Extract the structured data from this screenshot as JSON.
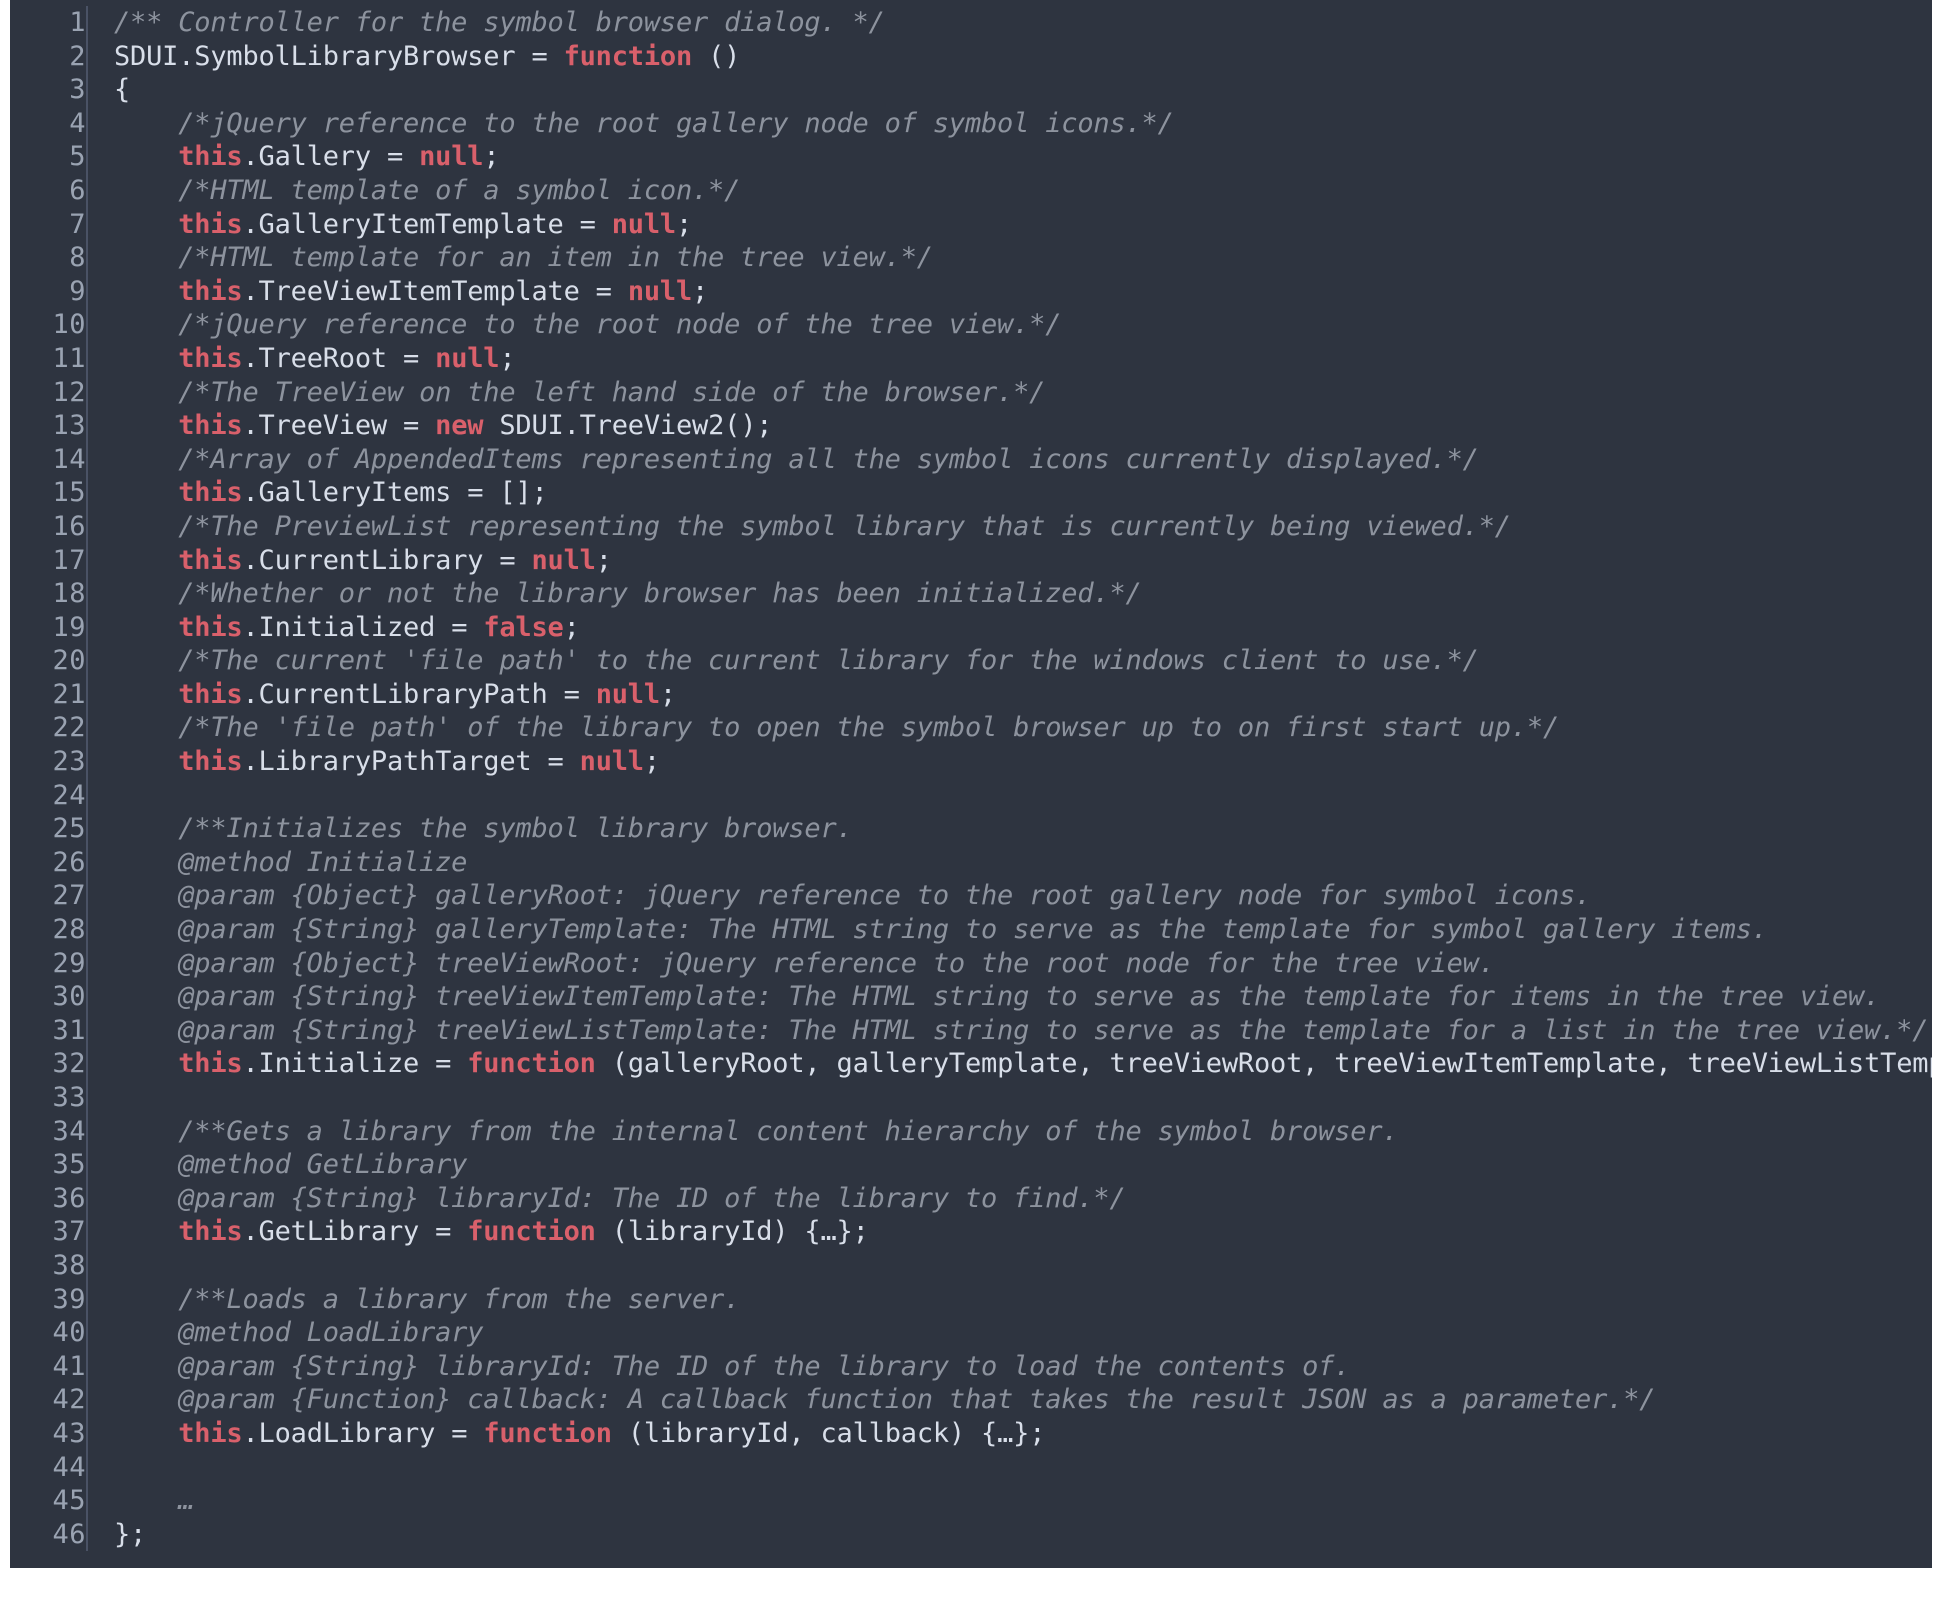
{
  "editor": {
    "background_color": "#2e3440",
    "gutter_color": "#9aa3b2",
    "gutter_divider_color": "#4a5265",
    "text_color": "#d8dee9",
    "comment_color": "#8d939e",
    "keyword_color": "#d9606b",
    "first_line_number": 1,
    "last_line_number": 46,
    "total_lines": 46,
    "language": "JavaScript"
  },
  "line_numbers": [
    "1",
    "2",
    "3",
    "4",
    "5",
    "6",
    "7",
    "8",
    "9",
    "10",
    "11",
    "12",
    "13",
    "14",
    "15",
    "16",
    "17",
    "18",
    "19",
    "20",
    "21",
    "22",
    "23",
    "24",
    "25",
    "26",
    "27",
    "28",
    "29",
    "30",
    "31",
    "32",
    "33",
    "34",
    "35",
    "36",
    "37",
    "38",
    "39",
    "40",
    "41",
    "42",
    "43",
    "44",
    "45",
    "46"
  ],
  "code_lines": [
    {
      "n": 1,
      "tokens": [
        {
          "t": "comment",
          "v": "/** Controller for the symbol browser dialog. */"
        }
      ]
    },
    {
      "n": 2,
      "tokens": [
        {
          "t": "plain",
          "v": "SDUI.SymbolLibraryBrowser = "
        },
        {
          "t": "keyword",
          "v": "function"
        },
        {
          "t": "plain",
          "v": " ()"
        }
      ]
    },
    {
      "n": 3,
      "tokens": [
        {
          "t": "plain",
          "v": "{"
        }
      ]
    },
    {
      "n": 4,
      "tokens": [
        {
          "t": "plain",
          "v": "    "
        },
        {
          "t": "comment",
          "v": "/*jQuery reference to the root gallery node of symbol icons.*/"
        }
      ]
    },
    {
      "n": 5,
      "tokens": [
        {
          "t": "plain",
          "v": "    "
        },
        {
          "t": "keyword",
          "v": "this"
        },
        {
          "t": "plain",
          "v": ".Gallery = "
        },
        {
          "t": "keyword",
          "v": "null"
        },
        {
          "t": "plain",
          "v": ";"
        }
      ]
    },
    {
      "n": 6,
      "tokens": [
        {
          "t": "plain",
          "v": "    "
        },
        {
          "t": "comment",
          "v": "/*HTML template of a symbol icon.*/"
        }
      ]
    },
    {
      "n": 7,
      "tokens": [
        {
          "t": "plain",
          "v": "    "
        },
        {
          "t": "keyword",
          "v": "this"
        },
        {
          "t": "plain",
          "v": ".GalleryItemTemplate = "
        },
        {
          "t": "keyword",
          "v": "null"
        },
        {
          "t": "plain",
          "v": ";"
        }
      ]
    },
    {
      "n": 8,
      "tokens": [
        {
          "t": "plain",
          "v": "    "
        },
        {
          "t": "comment",
          "v": "/*HTML template for an item in the tree view.*/"
        }
      ]
    },
    {
      "n": 9,
      "tokens": [
        {
          "t": "plain",
          "v": "    "
        },
        {
          "t": "keyword",
          "v": "this"
        },
        {
          "t": "plain",
          "v": ".TreeViewItemTemplate = "
        },
        {
          "t": "keyword",
          "v": "null"
        },
        {
          "t": "plain",
          "v": ";"
        }
      ]
    },
    {
      "n": 10,
      "tokens": [
        {
          "t": "plain",
          "v": "    "
        },
        {
          "t": "comment",
          "v": "/*jQuery reference to the root node of the tree view.*/"
        }
      ]
    },
    {
      "n": 11,
      "tokens": [
        {
          "t": "plain",
          "v": "    "
        },
        {
          "t": "keyword",
          "v": "this"
        },
        {
          "t": "plain",
          "v": ".TreeRoot = "
        },
        {
          "t": "keyword",
          "v": "null"
        },
        {
          "t": "plain",
          "v": ";"
        }
      ]
    },
    {
      "n": 12,
      "tokens": [
        {
          "t": "plain",
          "v": "    "
        },
        {
          "t": "comment",
          "v": "/*The TreeView on the left hand side of the browser.*/"
        }
      ]
    },
    {
      "n": 13,
      "tokens": [
        {
          "t": "plain",
          "v": "    "
        },
        {
          "t": "keyword",
          "v": "this"
        },
        {
          "t": "plain",
          "v": ".TreeView = "
        },
        {
          "t": "keyword",
          "v": "new"
        },
        {
          "t": "plain",
          "v": " SDUI.TreeView2();"
        }
      ]
    },
    {
      "n": 14,
      "tokens": [
        {
          "t": "plain",
          "v": "    "
        },
        {
          "t": "comment",
          "v": "/*Array of AppendedItems representing all the symbol icons currently displayed.*/"
        }
      ]
    },
    {
      "n": 15,
      "tokens": [
        {
          "t": "plain",
          "v": "    "
        },
        {
          "t": "keyword",
          "v": "this"
        },
        {
          "t": "plain",
          "v": ".GalleryItems = [];"
        }
      ]
    },
    {
      "n": 16,
      "tokens": [
        {
          "t": "plain",
          "v": "    "
        },
        {
          "t": "comment",
          "v": "/*The PreviewList representing the symbol library that is currently being viewed.*/"
        }
      ]
    },
    {
      "n": 17,
      "tokens": [
        {
          "t": "plain",
          "v": "    "
        },
        {
          "t": "keyword",
          "v": "this"
        },
        {
          "t": "plain",
          "v": ".CurrentLibrary = "
        },
        {
          "t": "keyword",
          "v": "null"
        },
        {
          "t": "plain",
          "v": ";"
        }
      ]
    },
    {
      "n": 18,
      "tokens": [
        {
          "t": "plain",
          "v": "    "
        },
        {
          "t": "comment",
          "v": "/*Whether or not the library browser has been initialized.*/"
        }
      ]
    },
    {
      "n": 19,
      "tokens": [
        {
          "t": "plain",
          "v": "    "
        },
        {
          "t": "keyword",
          "v": "this"
        },
        {
          "t": "plain",
          "v": ".Initialized = "
        },
        {
          "t": "keyword",
          "v": "false"
        },
        {
          "t": "plain",
          "v": ";"
        }
      ]
    },
    {
      "n": 20,
      "tokens": [
        {
          "t": "plain",
          "v": "    "
        },
        {
          "t": "comment",
          "v": "/*The current 'file path' to the current library for the windows client to use.*/"
        }
      ]
    },
    {
      "n": 21,
      "tokens": [
        {
          "t": "plain",
          "v": "    "
        },
        {
          "t": "keyword",
          "v": "this"
        },
        {
          "t": "plain",
          "v": ".CurrentLibraryPath = "
        },
        {
          "t": "keyword",
          "v": "null"
        },
        {
          "t": "plain",
          "v": ";"
        }
      ]
    },
    {
      "n": 22,
      "tokens": [
        {
          "t": "plain",
          "v": "    "
        },
        {
          "t": "comment",
          "v": "/*The 'file path' of the library to open the symbol browser up to on first start up.*/"
        }
      ]
    },
    {
      "n": 23,
      "tokens": [
        {
          "t": "plain",
          "v": "    "
        },
        {
          "t": "keyword",
          "v": "this"
        },
        {
          "t": "plain",
          "v": ".LibraryPathTarget = "
        },
        {
          "t": "keyword",
          "v": "null"
        },
        {
          "t": "plain",
          "v": ";"
        }
      ]
    },
    {
      "n": 24,
      "tokens": [
        {
          "t": "plain",
          "v": ""
        }
      ]
    },
    {
      "n": 25,
      "tokens": [
        {
          "t": "plain",
          "v": "    "
        },
        {
          "t": "comment",
          "v": "/**Initializes the symbol library browser."
        }
      ]
    },
    {
      "n": 26,
      "tokens": [
        {
          "t": "plain",
          "v": "    "
        },
        {
          "t": "comment",
          "v": "@method Initialize"
        }
      ]
    },
    {
      "n": 27,
      "tokens": [
        {
          "t": "plain",
          "v": "    "
        },
        {
          "t": "comment",
          "v": "@param {Object} galleryRoot: jQuery reference to the root gallery node for symbol icons."
        }
      ]
    },
    {
      "n": 28,
      "tokens": [
        {
          "t": "plain",
          "v": "    "
        },
        {
          "t": "comment",
          "v": "@param {String} galleryTemplate: The HTML string to serve as the template for symbol gallery items."
        }
      ]
    },
    {
      "n": 29,
      "tokens": [
        {
          "t": "plain",
          "v": "    "
        },
        {
          "t": "comment",
          "v": "@param {Object} treeViewRoot: jQuery reference to the root node for the tree view."
        }
      ]
    },
    {
      "n": 30,
      "tokens": [
        {
          "t": "plain",
          "v": "    "
        },
        {
          "t": "comment",
          "v": "@param {String} treeViewItemTemplate: The HTML string to serve as the template for items in the tree view."
        }
      ]
    },
    {
      "n": 31,
      "tokens": [
        {
          "t": "plain",
          "v": "    "
        },
        {
          "t": "comment",
          "v": "@param {String} treeViewListTemplate: The HTML string to serve as the template for a list in the tree view.*/"
        }
      ]
    },
    {
      "n": 32,
      "tokens": [
        {
          "t": "plain",
          "v": "    "
        },
        {
          "t": "keyword",
          "v": "this"
        },
        {
          "t": "plain",
          "v": ".Initialize = "
        },
        {
          "t": "keyword",
          "v": "function"
        },
        {
          "t": "plain",
          "v": " (galleryRoot, galleryTemplate, treeViewRoot, treeViewItemTemplate, treeViewListTemplate) {…};"
        }
      ]
    },
    {
      "n": 33,
      "tokens": [
        {
          "t": "plain",
          "v": ""
        }
      ]
    },
    {
      "n": 34,
      "tokens": [
        {
          "t": "plain",
          "v": "    "
        },
        {
          "t": "comment",
          "v": "/**Gets a library from the internal content hierarchy of the symbol browser."
        }
      ]
    },
    {
      "n": 35,
      "tokens": [
        {
          "t": "plain",
          "v": "    "
        },
        {
          "t": "comment",
          "v": "@method GetLibrary"
        }
      ]
    },
    {
      "n": 36,
      "tokens": [
        {
          "t": "plain",
          "v": "    "
        },
        {
          "t": "comment",
          "v": "@param {String} libraryId: The ID of the library to find.*/"
        }
      ]
    },
    {
      "n": 37,
      "tokens": [
        {
          "t": "plain",
          "v": "    "
        },
        {
          "t": "keyword",
          "v": "this"
        },
        {
          "t": "plain",
          "v": ".GetLibrary = "
        },
        {
          "t": "keyword",
          "v": "function"
        },
        {
          "t": "plain",
          "v": " (libraryId) {…};"
        }
      ]
    },
    {
      "n": 38,
      "tokens": [
        {
          "t": "plain",
          "v": ""
        }
      ]
    },
    {
      "n": 39,
      "tokens": [
        {
          "t": "plain",
          "v": "    "
        },
        {
          "t": "comment",
          "v": "/**Loads a library from the server."
        }
      ]
    },
    {
      "n": 40,
      "tokens": [
        {
          "t": "plain",
          "v": "    "
        },
        {
          "t": "comment",
          "v": "@method LoadLibrary"
        }
      ]
    },
    {
      "n": 41,
      "tokens": [
        {
          "t": "plain",
          "v": "    "
        },
        {
          "t": "comment",
          "v": "@param {String} libraryId: The ID of the library to load the contents of."
        }
      ]
    },
    {
      "n": 42,
      "tokens": [
        {
          "t": "plain",
          "v": "    "
        },
        {
          "t": "comment",
          "v": "@param {Function} callback: A callback function that takes the result JSON as a parameter.*/"
        }
      ]
    },
    {
      "n": 43,
      "tokens": [
        {
          "t": "plain",
          "v": "    "
        },
        {
          "t": "keyword",
          "v": "this"
        },
        {
          "t": "plain",
          "v": ".LoadLibrary = "
        },
        {
          "t": "keyword",
          "v": "function"
        },
        {
          "t": "plain",
          "v": " (libraryId, callback) {…};"
        }
      ]
    },
    {
      "n": 44,
      "tokens": [
        {
          "t": "plain",
          "v": ""
        }
      ]
    },
    {
      "n": 45,
      "tokens": [
        {
          "t": "plain",
          "v": "    "
        },
        {
          "t": "comment",
          "v": "…"
        }
      ]
    },
    {
      "n": 46,
      "tokens": [
        {
          "t": "plain",
          "v": "};"
        }
      ]
    }
  ]
}
